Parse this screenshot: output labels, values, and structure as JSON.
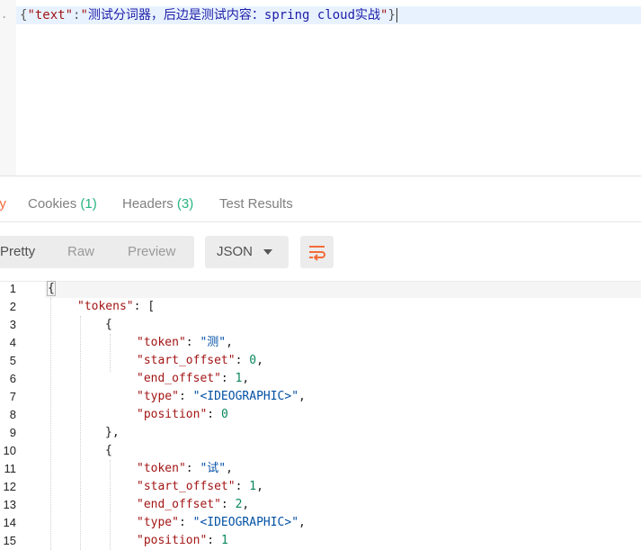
{
  "request_body": {
    "line_number": ".",
    "open": "{",
    "key": "\"text\"",
    "colon": ":",
    "value_open_quote": "\"",
    "value_text": "测试分词器，后边是测试内容：spring cloud实战",
    "value_close_quote": "\"",
    "close": "}"
  },
  "response_tabs": [
    {
      "label": "dy",
      "count": ""
    },
    {
      "label": "Cookies",
      "count": "(1)"
    },
    {
      "label": "Headers",
      "count": "(3)"
    },
    {
      "label": "Test Results",
      "count": ""
    }
  ],
  "view_modes": [
    "Pretty",
    "Raw",
    "Preview"
  ],
  "active_view": "Pretty",
  "format_select": {
    "value": "JSON"
  },
  "colors": {
    "active_tab": "#f26b3a",
    "count_green": "#26b47f",
    "json_key": "#a31515",
    "json_string": "#0451a5",
    "json_number": "#09885a",
    "wrap_icon": "#f26b3a"
  },
  "icons": {
    "wrap": "wrap-lines-icon",
    "dropdown": "chevron-down-icon"
  },
  "line_numbers": [
    "1",
    "2",
    "3",
    "4",
    "5",
    "6",
    "7",
    "8",
    "9",
    "10",
    "11",
    "12",
    "13",
    "14",
    "15"
  ],
  "response_lines": [
    {
      "parts": [
        {
          "t": "{",
          "c": "p"
        }
      ]
    },
    {
      "parts": [
        {
          "t": "\"tokens\"",
          "c": "k"
        },
        {
          "t": ": [",
          "c": "p"
        }
      ]
    },
    {
      "parts": [
        {
          "t": "{",
          "c": "p"
        }
      ]
    },
    {
      "parts": [
        {
          "t": "\"token\"",
          "c": "k"
        },
        {
          "t": ": ",
          "c": "p"
        },
        {
          "t": "\"测\"",
          "c": "vs"
        },
        {
          "t": ",",
          "c": "p"
        }
      ]
    },
    {
      "parts": [
        {
          "t": "\"start_offset\"",
          "c": "k"
        },
        {
          "t": ": ",
          "c": "p"
        },
        {
          "t": "0",
          "c": "vn"
        },
        {
          "t": ",",
          "c": "p"
        }
      ]
    },
    {
      "parts": [
        {
          "t": "\"end_offset\"",
          "c": "k"
        },
        {
          "t": ": ",
          "c": "p"
        },
        {
          "t": "1",
          "c": "vn"
        },
        {
          "t": ",",
          "c": "p"
        }
      ]
    },
    {
      "parts": [
        {
          "t": "\"type\"",
          "c": "k"
        },
        {
          "t": ": ",
          "c": "p"
        },
        {
          "t": "\"<IDEOGRAPHIC>\"",
          "c": "vs"
        },
        {
          "t": ",",
          "c": "p"
        }
      ]
    },
    {
      "parts": [
        {
          "t": "\"position\"",
          "c": "k"
        },
        {
          "t": ": ",
          "c": "p"
        },
        {
          "t": "0",
          "c": "vn"
        }
      ]
    },
    {
      "parts": [
        {
          "t": "},",
          "c": "p"
        }
      ]
    },
    {
      "parts": [
        {
          "t": "{",
          "c": "p"
        }
      ]
    },
    {
      "parts": [
        {
          "t": "\"token\"",
          "c": "k"
        },
        {
          "t": ": ",
          "c": "p"
        },
        {
          "t": "\"试\"",
          "c": "vs"
        },
        {
          "t": ",",
          "c": "p"
        }
      ]
    },
    {
      "parts": [
        {
          "t": "\"start_offset\"",
          "c": "k"
        },
        {
          "t": ": ",
          "c": "p"
        },
        {
          "t": "1",
          "c": "vn"
        },
        {
          "t": ",",
          "c": "p"
        }
      ]
    },
    {
      "parts": [
        {
          "t": "\"end_offset\"",
          "c": "k"
        },
        {
          "t": ": ",
          "c": "p"
        },
        {
          "t": "2",
          "c": "vn"
        },
        {
          "t": ",",
          "c": "p"
        }
      ]
    },
    {
      "parts": [
        {
          "t": "\"type\"",
          "c": "k"
        },
        {
          "t": ": ",
          "c": "p"
        },
        {
          "t": "\"<IDEOGRAPHIC>\"",
          "c": "vs"
        },
        {
          "t": ",",
          "c": "p"
        }
      ]
    },
    {
      "parts": [
        {
          "t": "\"position\"",
          "c": "k"
        },
        {
          "t": ": ",
          "c": "p"
        },
        {
          "t": "1",
          "c": "vn"
        }
      ]
    }
  ]
}
